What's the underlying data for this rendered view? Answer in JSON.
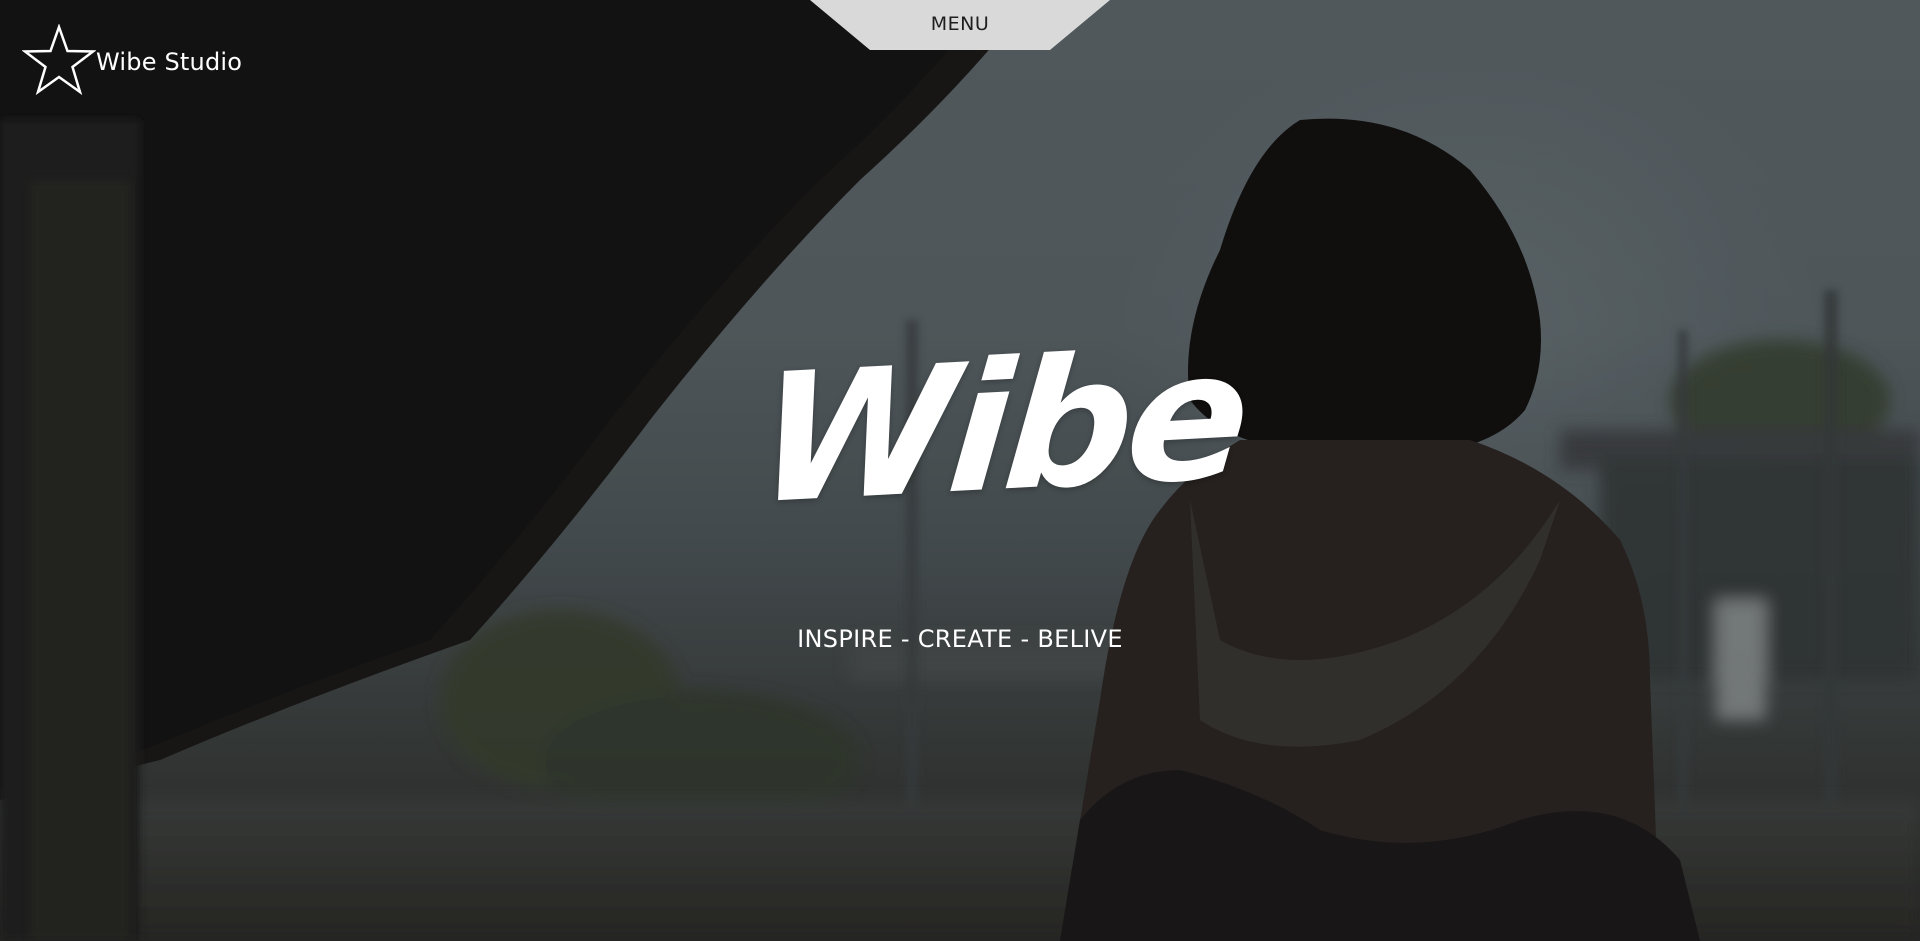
{
  "header": {
    "menu_label": "MENU",
    "logo_icon": "star-outline-icon",
    "logo_text": "Wibe Studio"
  },
  "hero": {
    "title": "Wibe",
    "tagline": "INSPIRE - CREATE - BELIVE"
  },
  "colors": {
    "menu_tab_bg": "#d9d9d9",
    "text_primary": "#ffffff",
    "menu_text": "#1e1e1e"
  }
}
